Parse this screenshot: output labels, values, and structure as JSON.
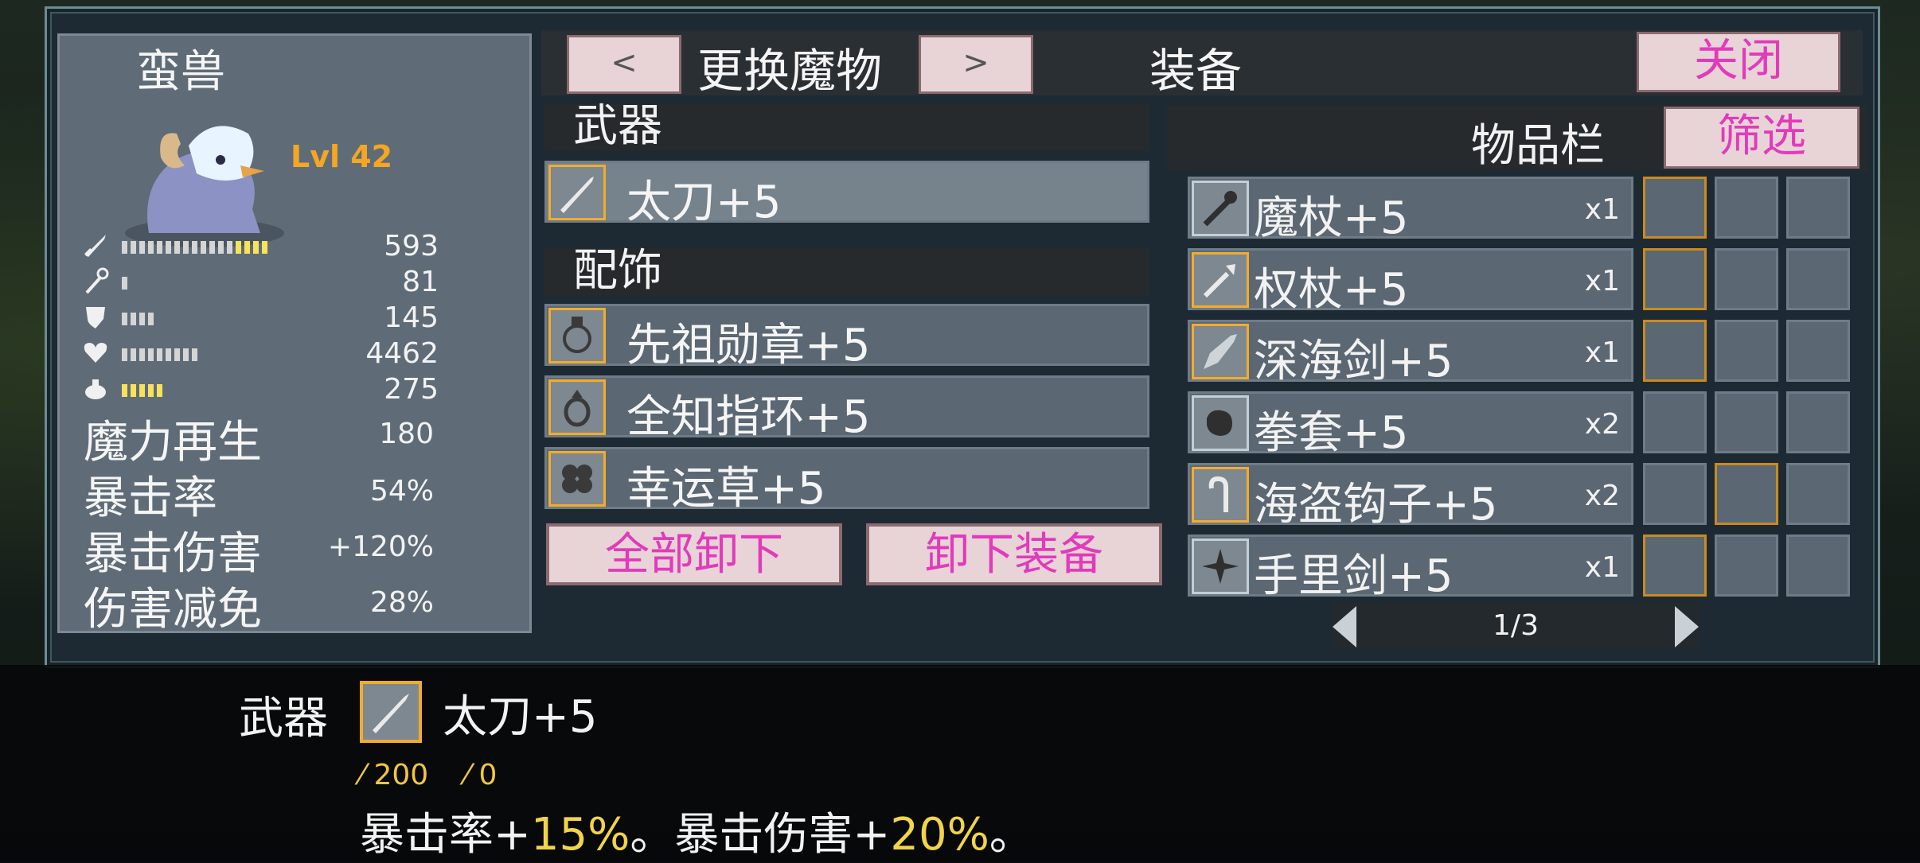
{
  "monster": {
    "name": "蛮兽",
    "level": "Lvl 42",
    "stats": [
      {
        "icon": "sword-icon",
        "value": "593",
        "bar_segments": 17,
        "bar_highlight": 4
      },
      {
        "icon": "staff-icon",
        "value": "81",
        "bar_segments": 1,
        "bar_highlight": 0
      },
      {
        "icon": "shield-icon",
        "value": "145",
        "bar_segments": 4,
        "bar_highlight": 0
      },
      {
        "icon": "heart-icon",
        "value": "4462",
        "bar_segments": 9,
        "bar_highlight": 0
      },
      {
        "icon": "potion-icon",
        "value": "275",
        "bar_segments": 5,
        "bar_highlight": 5
      }
    ],
    "derived": [
      {
        "label": "魔力再生",
        "value": "180"
      },
      {
        "label": "暴击率",
        "value": "54%"
      },
      {
        "label": "暴击伤害",
        "value": "+120%"
      },
      {
        "label": "伤害减免",
        "value": "28%"
      }
    ]
  },
  "topbar": {
    "prev_label": "<",
    "change_label": "更换魔物",
    "next_label": ">",
    "section_title": "装备",
    "close_label": "关闭"
  },
  "equipment": {
    "weapon_header": "武器",
    "weapon": {
      "name": "太刀+5",
      "icon": "katana-icon"
    },
    "accessory_header": "配饰",
    "accessories": [
      {
        "name": "先祖勋章+5",
        "icon": "medal-icon"
      },
      {
        "name": "全知指环+5",
        "icon": "ring-icon"
      },
      {
        "name": "幸运草+5",
        "icon": "clover-icon"
      }
    ],
    "unequip_all_label": "全部卸下",
    "unequip_label": "卸下装备"
  },
  "inventory": {
    "title": "物品栏",
    "filter_label": "筛选",
    "items": [
      {
        "name": "魔杖+5",
        "qty": "x1",
        "icon": "wand-icon",
        "gold": false
      },
      {
        "name": "权杖+5",
        "qty": "x1",
        "icon": "scepter-icon",
        "gold": true
      },
      {
        "name": "深海剑+5",
        "qty": "x1",
        "icon": "deepsea-sword-icon",
        "gold": true
      },
      {
        "name": "拳套+5",
        "qty": "x2",
        "icon": "gauntlet-icon",
        "gold": false
      },
      {
        "name": "海盗钩子+5",
        "qty": "x2",
        "icon": "pirate-hook-icon",
        "gold": true
      },
      {
        "name": "手里剑+5",
        "qty": "x1",
        "icon": "shuriken-icon",
        "gold": false
      }
    ],
    "page": "1/3"
  },
  "tooltip": {
    "category": "武器",
    "name": "太刀+5",
    "attack": "200",
    "magic": "0",
    "desc_part1": "暴击率+",
    "crit_rate": "15%",
    "desc_part2": "。暴击伤害+",
    "crit_damage": "20%",
    "desc_part3": "。"
  }
}
